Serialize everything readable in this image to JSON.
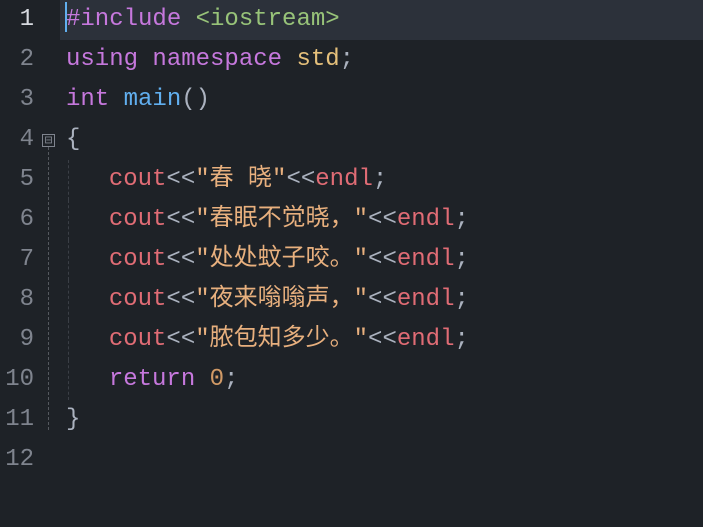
{
  "lines": {
    "l1": "1",
    "l2": "2",
    "l3": "3",
    "l4": "4",
    "l5": "5",
    "l6": "6",
    "l7": "7",
    "l8": "8",
    "l9": "9",
    "l10": "10",
    "l11": "11",
    "l12": "12"
  },
  "fold": {
    "minus": "⊟"
  },
  "code": {
    "include_directive": "#include",
    "include_header": " <iostream>",
    "using": "using",
    "namespace": " namespace",
    "std": " std",
    "semi": ";",
    "int": "int",
    "main": " main",
    "parens": "()",
    "lbrace": "{",
    "rbrace": "}",
    "cout": "cout",
    "ltlt": "<<",
    "endl": "endl",
    "return": "return",
    "zero": " 0",
    "str1": "\"春 晓\"",
    "str2": "\"春眠不觉晓，\"",
    "str3": "\"处处蚊子咬。\"",
    "str4": "\"夜来嗡嗡声，\"",
    "str5": "\"脓包知多少。\""
  }
}
